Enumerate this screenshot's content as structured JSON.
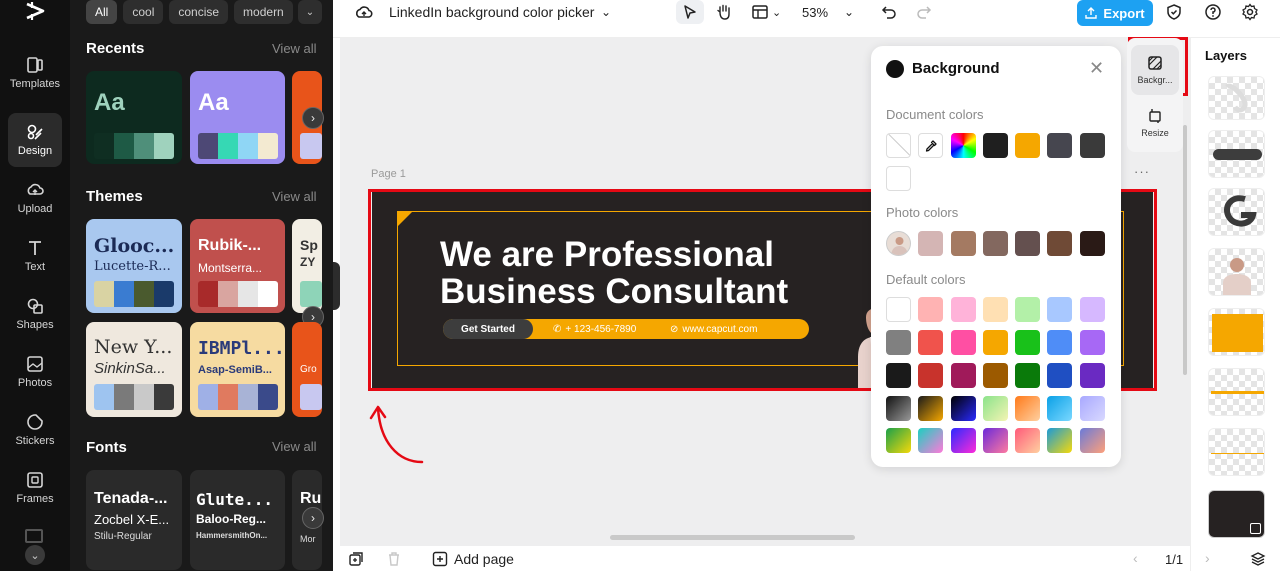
{
  "rail": {
    "items": [
      {
        "label": "Templates",
        "icon": "templates-icon"
      },
      {
        "label": "Design",
        "icon": "design-icon"
      },
      {
        "label": "Upload",
        "icon": "upload-icon"
      },
      {
        "label": "Text",
        "icon": "text-icon"
      },
      {
        "label": "Shapes",
        "icon": "shapes-icon"
      },
      {
        "label": "Photos",
        "icon": "photos-icon"
      },
      {
        "label": "Stickers",
        "icon": "stickers-icon"
      },
      {
        "label": "Frames",
        "icon": "frames-icon"
      }
    ]
  },
  "panel": {
    "chips": [
      "All",
      "cool",
      "concise",
      "modern"
    ],
    "recents": {
      "title": "Recents",
      "link": "View all",
      "cards": [
        {
          "sample": "Aa",
          "bg": "#0d2a1f",
          "swatches": [
            "#0f2e22",
            "#1e5a45",
            "#4f8f7a",
            "#9fd2bd"
          ]
        },
        {
          "sample": "Aa",
          "bg": "#9b8cf0",
          "swatches": [
            "#4d4875",
            "#36d8b4",
            "#8fd6f5",
            "#f3ead1"
          ]
        }
      ]
    },
    "themes": {
      "title": "Themes",
      "link": "View all",
      "cards": [
        {
          "title": "Glooc...",
          "sub": "Lucette-R...",
          "bg": "#a9c8ef",
          "fg": "#1b2a55",
          "swatches": [
            "#d9d3a3",
            "#3a7cd1",
            "#4a5a2e",
            "#1a3a6a"
          ]
        },
        {
          "title": "Rubik-...",
          "sub": "Montserra...",
          "bg": "#c0504d",
          "fg": "#ffffff",
          "swatches": [
            "#a82a2a",
            "#d9a5a0",
            "#e6e6e6",
            "#ffffff"
          ]
        },
        {
          "title": "New Y...",
          "sub": "SinkinSa...",
          "bg": "#efe8de",
          "fg": "#333333",
          "swatches": [
            "#9ec4f0",
            "#7a7a7a",
            "#c9c9c9",
            "#3a3a3a"
          ]
        },
        {
          "title": "IBMPl...",
          "sub": "Asap-SemiB...",
          "bg": "#f6dba1",
          "fg": "#2a3a7a",
          "swatches": [
            "#9fb0e6",
            "#e07a5f",
            "#a8b3d6",
            "#3a4a8a"
          ]
        }
      ]
    },
    "fonts": {
      "title": "Fonts",
      "link": "View all",
      "cards": [
        {
          "line1": "Tenada-...",
          "line2": "Zocbel X-E...",
          "line3": "Stilu-Regular"
        },
        {
          "line1": "Glute...",
          "line2": "Baloo-Reg...",
          "line3": "HammersmithOn..."
        }
      ]
    }
  },
  "topbar": {
    "doc_title": "LinkedIn background color picker",
    "zoom": "53%",
    "export_label": "Export"
  },
  "canvas": {
    "page_label": "Page 1",
    "banner": {
      "headline_1": "We are Professional",
      "headline_2": "Business Consultant",
      "cta": "Get Started",
      "phone": "+ 123-456-7890",
      "website": "www.capcut.com"
    }
  },
  "popover": {
    "title": "Background",
    "document_colors_label": "Document colors",
    "photo_colors_label": "Photo colors",
    "default_colors_label": "Default colors",
    "document_colors": [
      "#1f1f1f",
      "#f5a700",
      "#46464f",
      "#3a3a3a"
    ],
    "photo_colors": [
      "#d4b5b4",
      "#a47a62",
      "#83685f",
      "#64504f",
      "#6f4a36",
      "#2a1a16"
    ],
    "default_colors": [
      [
        "#ffffff",
        "#ffb3b3",
        "#ffb3d9",
        "#ffe0b3",
        "#b3f0a8",
        "#a8c8ff",
        "#d6b8ff"
      ],
      [
        "#808080",
        "#f0534c",
        "#ff4fa3",
        "#f5a700",
        "#19c11a",
        "#4f8df7",
        "#a768f5"
      ],
      [
        "#1a1a1a",
        "#c8332c",
        "#a01a5a",
        "#9c5a00",
        "#0a7a0a",
        "#1f4fc2",
        "#6a2ac2"
      ]
    ],
    "gradients": [
      [
        "linear-gradient(135deg,#111,#999)",
        "linear-gradient(135deg,#1a1a1a,#f5a700)",
        "linear-gradient(135deg,#000,#2a2aff)",
        "linear-gradient(135deg,#8be38b,#f4f4b3)",
        "linear-gradient(135deg,#ff7a1a,#ffd0a0)",
        "linear-gradient(135deg,#0aa0e6,#7ad8ff)",
        "linear-gradient(135deg,#a8a8ff,#d9d9ff)"
      ],
      [
        "linear-gradient(135deg,#1aa04a,#f5d90a)",
        "linear-gradient(135deg,#1ad0c0,#ff7ad9)",
        "linear-gradient(135deg,#2a2aff,#ff2ad9)",
        "linear-gradient(135deg,#6a2ad9,#ff7aa0)",
        "linear-gradient(135deg,#ff5a7a,#ffd0a0)",
        "linear-gradient(135deg,#1a9ad9,#f5d90a)",
        "linear-gradient(135deg,#6a7ad9,#ffa07a)"
      ]
    ]
  },
  "side_tabs": [
    {
      "label": "Backgr...",
      "icon": "background-icon"
    },
    {
      "label": "Resize",
      "icon": "resize-icon"
    }
  ],
  "layers": {
    "title": "Layers"
  },
  "bottombar": {
    "add_page": "Add page",
    "page_count": "1/1"
  }
}
